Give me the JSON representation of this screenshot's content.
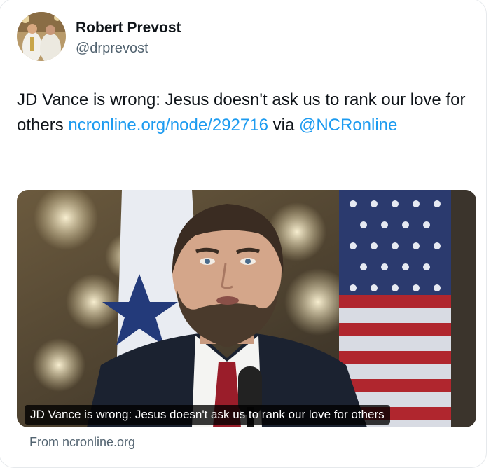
{
  "author": {
    "display_name": "Robert Prevost",
    "handle": "@drprevost",
    "avatar_icon": "profile-photo-icon"
  },
  "tweet": {
    "text_prefix": "JD Vance is wrong: Jesus doesn't ask us to rank our love for others ",
    "link": "ncronline.org/node/292716",
    "text_via": " via ",
    "mention": "@NCRonline"
  },
  "link_card": {
    "image_icon": "photo-icon",
    "caption": "JD Vance is wrong: Jesus doesn't ask us to rank our love for others",
    "source": "From ncronline.org"
  },
  "colors": {
    "link": "#1d9bf0",
    "secondary_text": "#536471",
    "primary_text": "#0f1419"
  }
}
